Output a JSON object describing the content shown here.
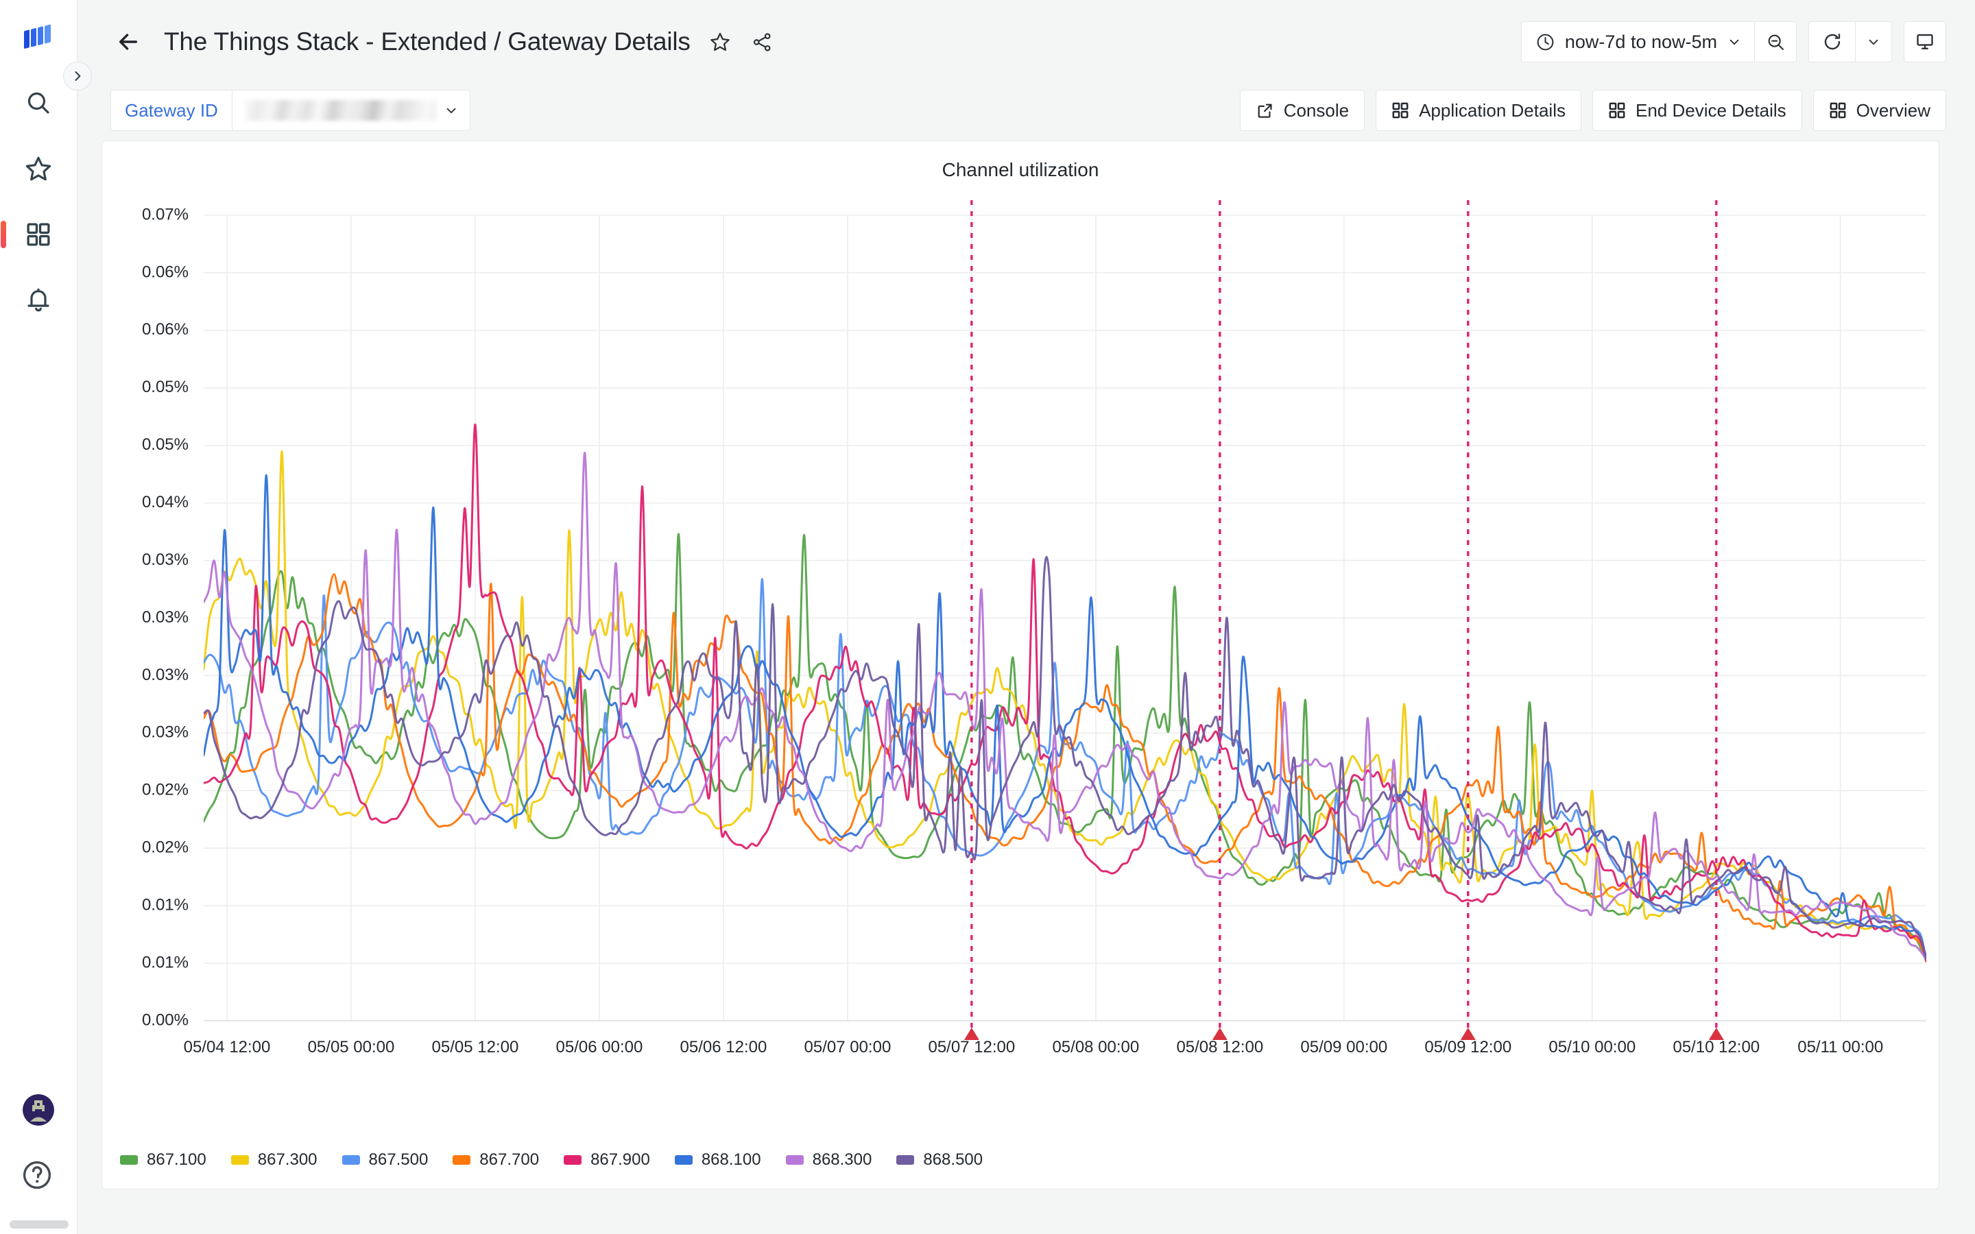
{
  "app": {
    "logo_name": "grafana-logo",
    "nav_items": [
      {
        "name": "search",
        "icon": "search-icon",
        "active": false
      },
      {
        "name": "starred",
        "icon": "star-icon",
        "active": false
      },
      {
        "name": "dashboards",
        "icon": "dashboards-icon",
        "active": true
      },
      {
        "name": "alerting",
        "icon": "bell-icon",
        "active": false
      }
    ],
    "help_icon": "help-circle-icon",
    "avatar_name": "user-avatar",
    "expand_icon": "chevron-right-icon"
  },
  "header": {
    "back_icon": "arrow-left-icon",
    "title": "The Things Stack - Extended / Gateway Details",
    "star_icon": "star-outline-icon",
    "share_icon": "share-nodes-icon",
    "time_range": "now-7d to now-5m",
    "time_icon": "clock-icon",
    "time_caret_icon": "chevron-down-icon",
    "zoom_out_icon": "zoom-out-icon",
    "refresh_icon": "refresh-icon",
    "refresh_caret_icon": "chevron-down-icon",
    "tv_icon": "tv-mode-icon"
  },
  "subbar": {
    "variable_label": "Gateway ID",
    "variable_value": "",
    "variable_caret_icon": "chevron-down-icon",
    "links": [
      {
        "label": "Console",
        "icon": "external-link-icon"
      },
      {
        "label": "Application Details",
        "icon": "apps-icon"
      },
      {
        "label": "End Device Details",
        "icon": "apps-icon"
      },
      {
        "label": "Overview",
        "icon": "apps-icon"
      }
    ]
  },
  "panel": {
    "title": "Channel utilization"
  },
  "chart_data": {
    "type": "line",
    "title": "Channel utilization",
    "xlabel": "",
    "ylabel": "",
    "grid": true,
    "legend_position": "bottom",
    "x_tick_labels": [
      "05/04 12:00",
      "05/05 00:00",
      "05/05 12:00",
      "05/06 00:00",
      "05/06 12:00",
      "05/07 00:00",
      "05/07 12:00",
      "05/08 00:00",
      "05/08 12:00",
      "05/09 00:00",
      "05/09 12:00",
      "05/10 00:00",
      "05/10 12:00",
      "05/11 00:00"
    ],
    "y_tick_labels": [
      "0.07%",
      "0.06%",
      "0.06%",
      "0.05%",
      "0.05%",
      "0.04%",
      "0.03%",
      "0.03%",
      "0.03%",
      "0.03%",
      "0.02%",
      "0.02%",
      "0.01%",
      "0.01%",
      "0.00%"
    ],
    "y_tick_values": [
      0.07,
      0.065,
      0.06,
      0.055,
      0.05,
      0.045,
      0.04,
      0.035,
      0.03,
      0.025,
      0.02,
      0.015,
      0.01,
      0.005,
      0.0
    ],
    "ylim": [
      0,
      0.07
    ],
    "yunit": "%",
    "xlim": [
      "05/04 12:00",
      "05/11 00:00"
    ],
    "annotations": [
      {
        "x": "05/07 12:00",
        "color": "#e0226e",
        "style": "dashed"
      },
      {
        "x": "05/08 12:00",
        "color": "#e0226e",
        "style": "dashed"
      },
      {
        "x": "05/09 12:00",
        "color": "#e0226e",
        "style": "dashed"
      },
      {
        "x": "05/10 12:00",
        "color": "#e0226e",
        "style": "dashed"
      }
    ],
    "series": [
      {
        "name": "867.100",
        "color": "#56a64b",
        "seed": 11,
        "amp": 0.0215,
        "base": 0.015,
        "freq": 30.5,
        "decay": 0.46,
        "phase": 0.15
      },
      {
        "name": "867.300",
        "color": "#f2cc0c",
        "seed": 23,
        "amp": 0.0205,
        "base": 0.015,
        "freq": 29.0,
        "decay": 0.44,
        "phase": 0.85
      },
      {
        "name": "867.500",
        "color": "#5794f2",
        "seed": 37,
        "amp": 0.0175,
        "base": 0.0155,
        "freq": 31.5,
        "decay": 0.4,
        "phase": 1.6
      },
      {
        "name": "867.700",
        "color": "#ff780a",
        "seed": 51,
        "amp": 0.02,
        "base": 0.015,
        "freq": 28.5,
        "decay": 0.42,
        "phase": 2.35
      },
      {
        "name": "867.900",
        "color": "#e0226e",
        "seed": 67,
        "amp": 0.0215,
        "base": 0.015,
        "freq": 30.0,
        "decay": 0.45,
        "phase": 3.1
      },
      {
        "name": "868.100",
        "color": "#3274d9",
        "seed": 83,
        "amp": 0.017,
        "base": 0.016,
        "freq": 32.0,
        "decay": 0.38,
        "phase": 3.85
      },
      {
        "name": "868.300",
        "color": "#b877d9",
        "seed": 97,
        "amp": 0.019,
        "base": 0.015,
        "freq": 29.5,
        "decay": 0.43,
        "phase": 4.6
      },
      {
        "name": "868.500",
        "color": "#705da0",
        "seed": 113,
        "amp": 0.0195,
        "base": 0.0155,
        "freq": 30.8,
        "decay": 0.41,
        "phase": 5.35
      }
    ]
  }
}
